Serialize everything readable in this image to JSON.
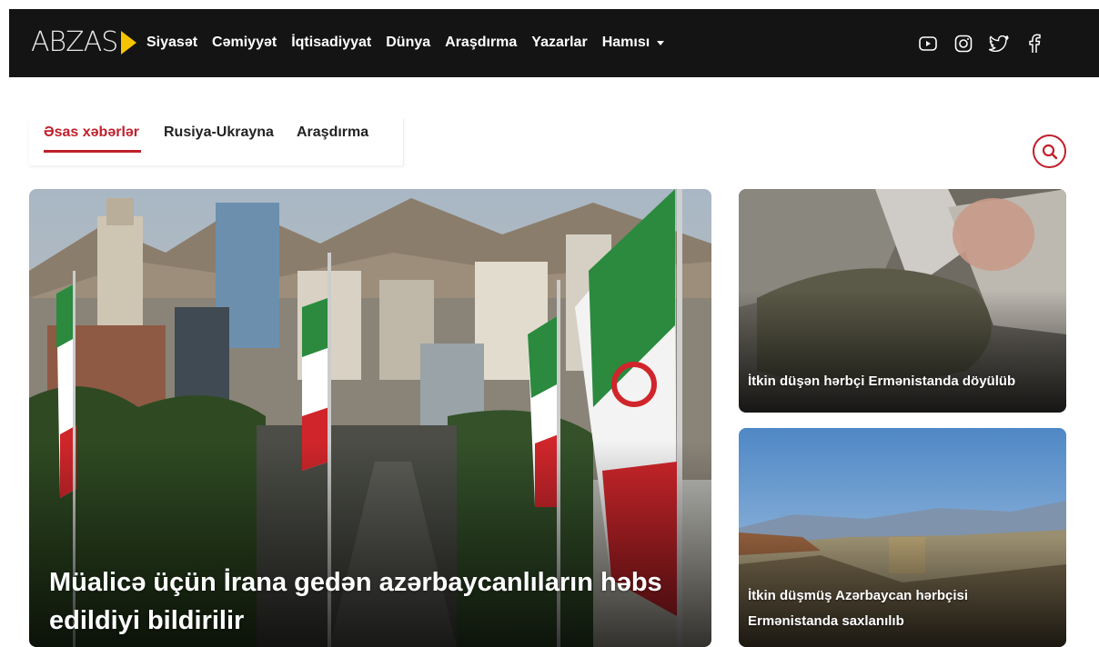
{
  "brand": {
    "logo_text": "ABZAS",
    "accent": "#f5c400"
  },
  "nav": {
    "items": [
      "Siyasət",
      "Cəmiyyət",
      "İqtisadiyyat",
      "Dünya",
      "Araşdırma",
      "Yazarlar"
    ],
    "more_label": "Hamısı"
  },
  "socials": [
    "youtube-icon",
    "instagram-icon",
    "twitter-icon",
    "facebook-icon"
  ],
  "tabs": {
    "items": [
      "Əsas xəbərlər",
      "Rusiya-Ukrayna",
      "Araşdırma"
    ],
    "active_index": 0,
    "active_color": "#c0202b"
  },
  "search": {
    "icon": "search-icon"
  },
  "main_story": {
    "title": "Müalicə üçün İrana gedən azərbaycanlıların həbs edildiyi bildirilir"
  },
  "side_stories": [
    {
      "title": "İtkin düşən hərbçi Ermənistanda döyülüb"
    },
    {
      "title": "İtkin düşmüş Azərbaycan hərbçisi Ermənistanda saxlanılıb"
    }
  ]
}
